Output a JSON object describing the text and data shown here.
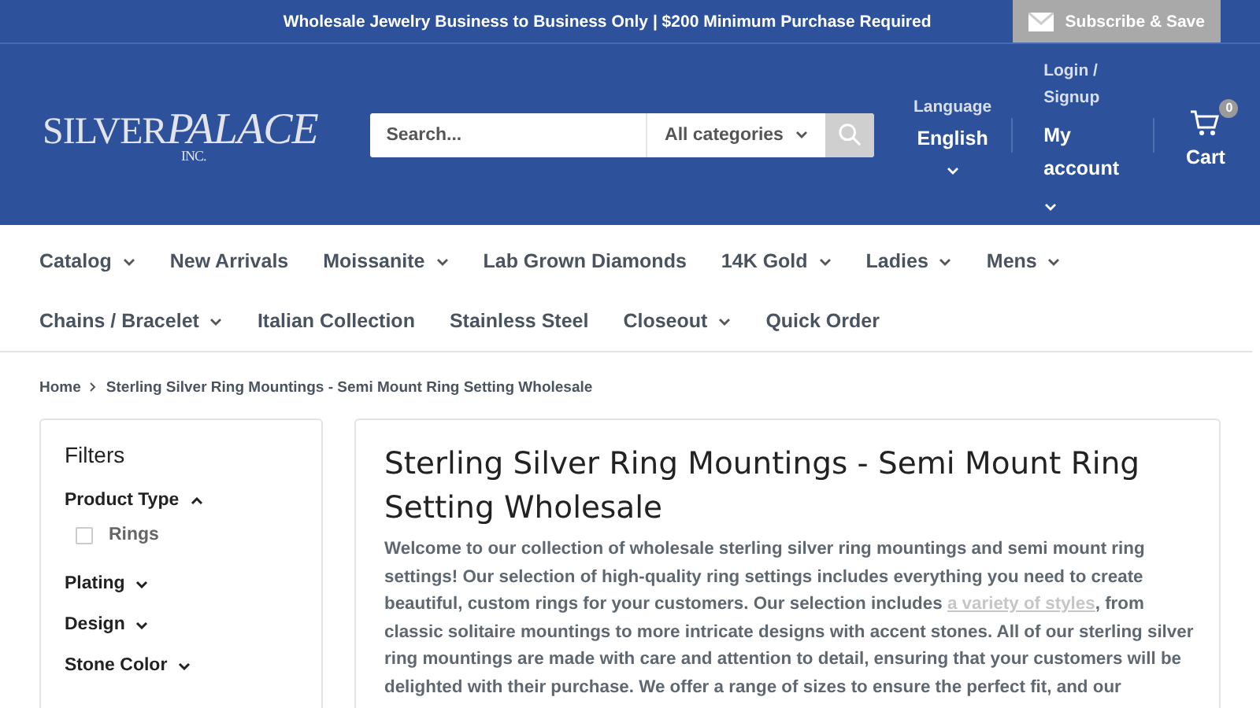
{
  "announcement": {
    "text": "Wholesale Jewelry Business to Business Only | $200 Minimum Purchase Required",
    "button": "Subscribe & Save"
  },
  "logo": {
    "name": "SILVER",
    "name2": "PALACE",
    "suffix": "INC."
  },
  "search": {
    "placeholder": "Search...",
    "category": "All categories"
  },
  "language": {
    "label": "Language",
    "value": "English"
  },
  "account": {
    "label": "Login / Signup",
    "value": "My account"
  },
  "cart": {
    "label": "Cart",
    "count": "0"
  },
  "nav": [
    {
      "label": "Catalog",
      "dropdown": true
    },
    {
      "label": "New Arrivals",
      "dropdown": false
    },
    {
      "label": "Moissanite",
      "dropdown": true
    },
    {
      "label": "Lab Grown Diamonds",
      "dropdown": false
    },
    {
      "label": "14K Gold",
      "dropdown": true
    },
    {
      "label": "Ladies",
      "dropdown": true
    },
    {
      "label": "Mens",
      "dropdown": true
    },
    {
      "label": "Chains / Bracelet",
      "dropdown": true
    },
    {
      "label": "Italian Collection",
      "dropdown": false
    },
    {
      "label": "Stainless Steel",
      "dropdown": false
    },
    {
      "label": "Closeout",
      "dropdown": true
    },
    {
      "label": "Quick Order",
      "dropdown": false
    }
  ],
  "breadcrumb": [
    "Home",
    "Sterling Silver Ring Mountings - Semi Mount Ring Setting Wholesale"
  ],
  "filters": {
    "title": "Filters",
    "groups": [
      {
        "label": "Product Type",
        "expanded": true,
        "options": [
          {
            "label": "Rings",
            "checked": false
          }
        ]
      },
      {
        "label": "Plating",
        "expanded": false
      },
      {
        "label": "Design",
        "expanded": false
      },
      {
        "label": "Stone Color",
        "expanded": false
      }
    ]
  },
  "content": {
    "title": "Sterling Silver Ring Mountings - Semi Mount Ring Setting Wholesale",
    "text_before": "Welcome to our collection of wholesale sterling silver ring mountings and semi mount ring settings! Our selection of high-quality ring settings includes everything you need to create beautiful, custom rings for your customers. Our selection includes ",
    "link": "a variety of styles",
    "text_after": ", from classic solitaire mountings to more intricate designs with accent stones. All of our sterling silver ring mountings are made with care and attention to detail, ensuring that your customers will be delighted with their purchase. We offer a range of sizes to ensure the perfect fit, and our"
  }
}
